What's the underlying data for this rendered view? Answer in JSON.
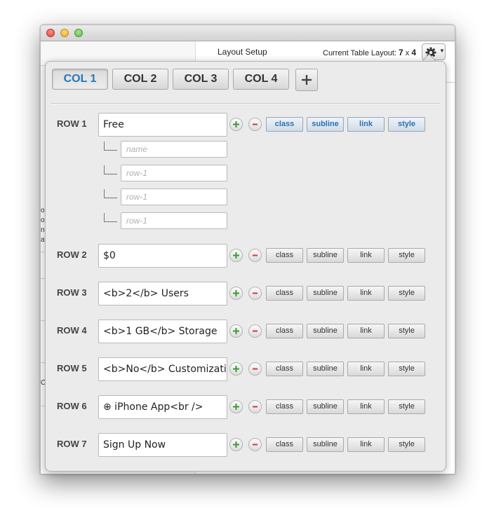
{
  "header": {
    "title": "Layout Setup",
    "current_layout_label": "Current Table Layout:",
    "rows": "7",
    "times": "x",
    "cols": "4"
  },
  "left_pane_fragments": [
    "o",
    "o",
    "n",
    "at",
    "C"
  ],
  "tabs": [
    {
      "label": "COL 1",
      "active": true
    },
    {
      "label": "COL 2",
      "active": false
    },
    {
      "label": "COL 3",
      "active": false
    },
    {
      "label": "COL 4",
      "active": false
    }
  ],
  "action_labels": {
    "class": "class",
    "subline": "subline",
    "link": "link",
    "style": "style"
  },
  "rows": [
    {
      "label": "ROW 1",
      "value": "Free"
    },
    {
      "label": "ROW 2",
      "value": "$0"
    },
    {
      "label": "ROW 3",
      "value": "<b>2</b> Users"
    },
    {
      "label": "ROW 4",
      "value": "<b>1 GB</b> Storage"
    },
    {
      "label": "ROW 5",
      "value": "<b>No</b> Customizati"
    },
    {
      "label": "ROW 6",
      "value": "⊕ iPhone App<br />"
    },
    {
      "label": "ROW 7",
      "value": "Sign Up Now"
    }
  ],
  "row1_sub_fields": [
    {
      "placeholder": "name"
    },
    {
      "placeholder": "row-1"
    },
    {
      "placeholder": "row-1"
    },
    {
      "placeholder": "row-1"
    }
  ],
  "colors": {
    "accent": "#2876b8",
    "plus": "#3a9a34",
    "minus": "#d03a3a"
  }
}
